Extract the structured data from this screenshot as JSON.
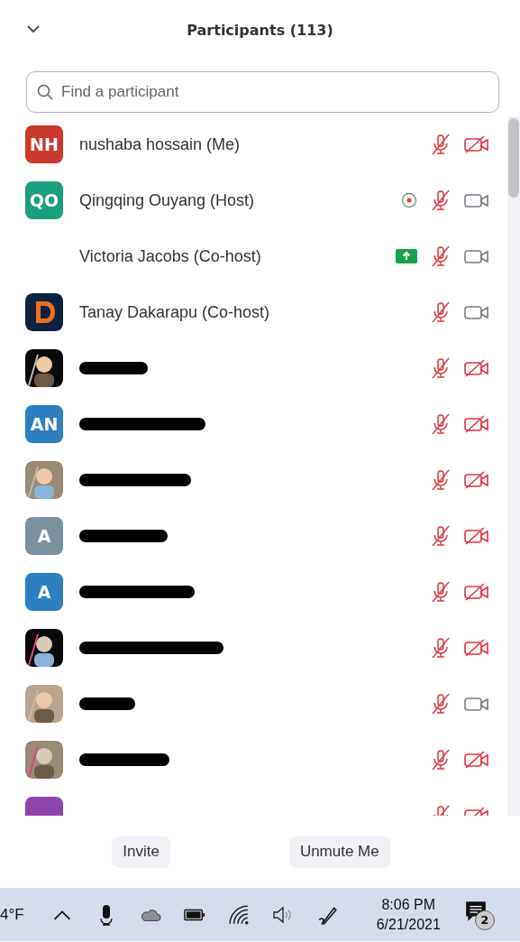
{
  "header": {
    "title": "Participants (113)"
  },
  "search": {
    "placeholder": "Find a participant"
  },
  "participants": [
    {
      "avatar": {
        "kind": "initials",
        "text": "NH",
        "color": "#c9392b"
      },
      "name": "nushaba hossain (Me)",
      "redacted": false,
      "mic_muted": true,
      "video_on": false
    },
    {
      "avatar": {
        "kind": "initials",
        "text": "QO",
        "color": "#1b9e7e"
      },
      "name": "Qingqing Ouyang (Host)",
      "redacted": false,
      "badge": {
        "kind": "recording"
      },
      "mic_muted": true,
      "video_on": true
    },
    {
      "avatar": {
        "kind": "none"
      },
      "name": "Victoria Jacobs (Co-host)",
      "redacted": false,
      "badge": {
        "kind": "upload"
      },
      "mic_muted": true,
      "video_on": true
    },
    {
      "avatar": {
        "kind": "logo"
      },
      "name": "Tanay Dakarapu (Co-host)",
      "redacted": false,
      "mic_muted": true,
      "video_on": true
    },
    {
      "redacted": true,
      "mic_muted": true,
      "video_on": false
    },
    {
      "avatar": {
        "kind": "initials",
        "text": "AN",
        "color": "#2d7fc0"
      },
      "redacted": true,
      "mic_muted": true,
      "video_on": false
    },
    {
      "redacted": true,
      "mic_muted": true,
      "video_on": false
    },
    {
      "avatar": {
        "kind": "initials",
        "text": "A",
        "color": "#7c909e"
      },
      "redacted": true,
      "mic_muted": true,
      "video_on": false
    },
    {
      "avatar": {
        "kind": "initials",
        "text": "A",
        "color": "#2d7fc0"
      },
      "redacted": true,
      "mic_muted": true,
      "video_on": false
    },
    {
      "redacted": true,
      "mic_muted": true,
      "video_on": false
    },
    {
      "redacted": true,
      "mic_muted": true,
      "video_on": true
    },
    {
      "redacted": true,
      "mic_muted": true,
      "video_on": false
    },
    {
      "avatar": {
        "kind": "initials",
        "color": "#8e44ad"
      },
      "redacted": false,
      "mic_muted": true,
      "video_on": false
    }
  ],
  "buttons": [
    "Invite",
    "Unmute Me"
  ],
  "taskbar": {
    "weather": "4°F",
    "time": "8:06 PM",
    "date": "6/21/2021",
    "notifications": "2"
  }
}
